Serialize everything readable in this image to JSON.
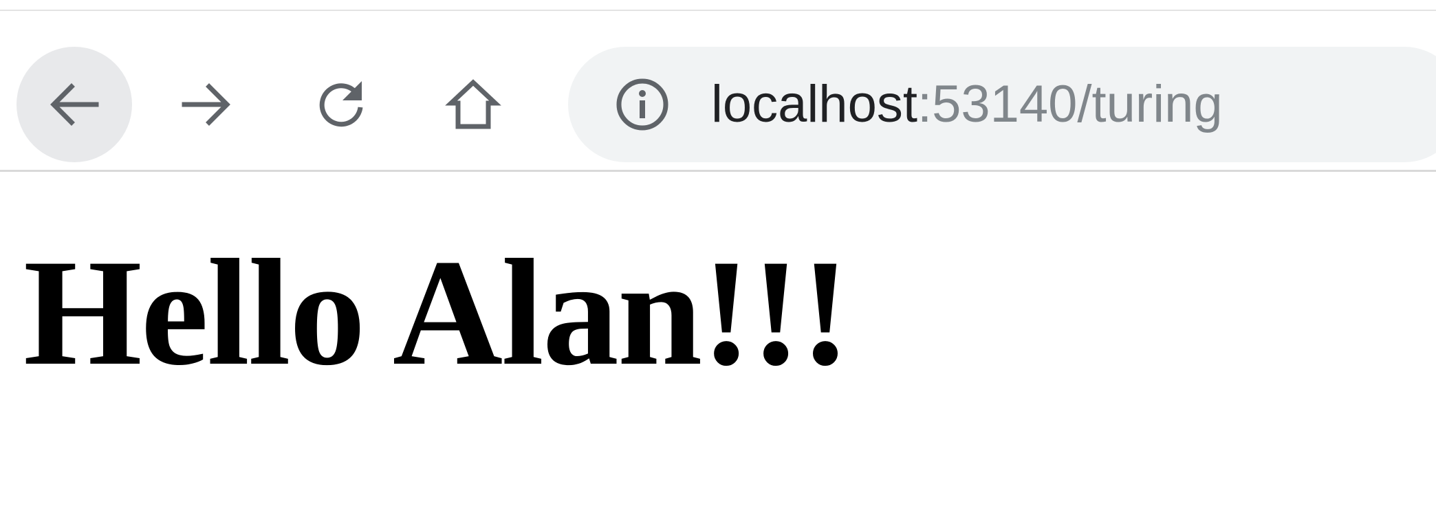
{
  "toolbar": {
    "buttons": [
      {
        "name": "back",
        "icon": "arrow-left-icon"
      },
      {
        "name": "forward",
        "icon": "arrow-right-icon"
      },
      {
        "name": "reload",
        "icon": "reload-icon"
      },
      {
        "name": "home",
        "icon": "home-icon"
      }
    ],
    "address_bar": {
      "icon": "info-icon",
      "url_host": "localhost",
      "url_rest": ":53140/turing"
    }
  },
  "page": {
    "heading": "Hello Alan!!!"
  },
  "colors": {
    "icon": "#5f6368",
    "omnibox_bg": "#f1f3f4",
    "active_button_bg": "#e8e9eb",
    "url_host": "#202124",
    "url_rest": "#80868b",
    "heading": "#000000"
  }
}
